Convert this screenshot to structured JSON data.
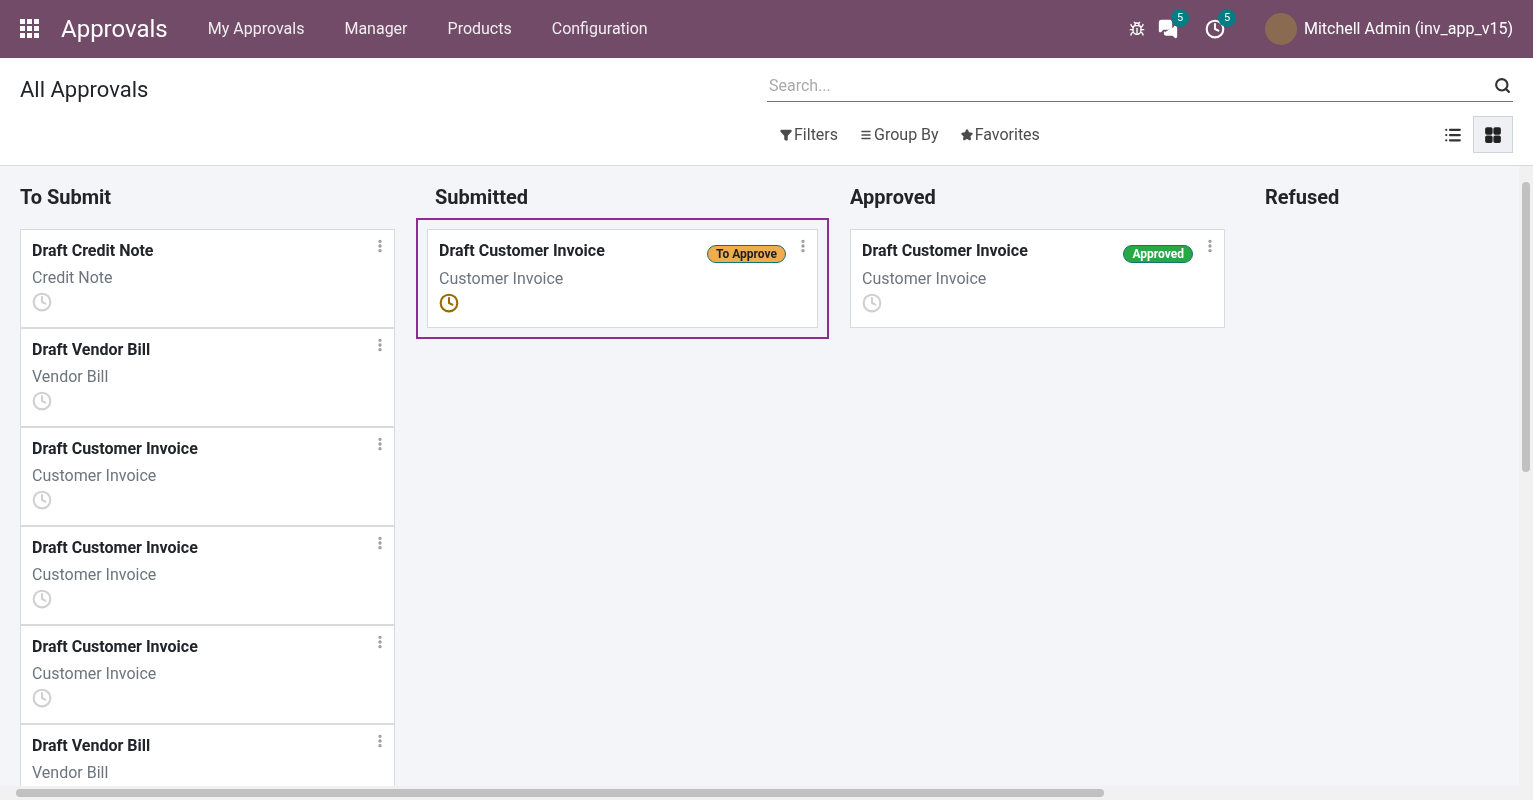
{
  "navbar": {
    "app_title": "Approvals",
    "menu": [
      "My Approvals",
      "Manager",
      "Products",
      "Configuration"
    ],
    "messages_count": "5",
    "activities_count": "5",
    "user": "Mitchell Admin (inv_app_v15)"
  },
  "control_panel": {
    "title": "All Approvals",
    "search": {
      "placeholder": "Search..."
    },
    "filters": [
      "Filters",
      "Group By",
      "Favorites"
    ],
    "views": [
      {
        "kind": "list",
        "selected": false
      },
      {
        "kind": "kanban",
        "selected": true
      }
    ]
  },
  "columns": [
    {
      "title": "To Submit",
      "cards": [
        {
          "title": "Draft Credit Note",
          "subtitle": "Credit Note",
          "activity_planned": false,
          "selected": false
        },
        {
          "title": "Draft Vendor Bill",
          "subtitle": "Vendor Bill",
          "activity_planned": false,
          "selected": false
        },
        {
          "title": "Draft Customer Invoice",
          "subtitle": "Customer Invoice",
          "activity_planned": false,
          "selected": false
        },
        {
          "title": "Draft Customer Invoice",
          "subtitle": "Customer Invoice",
          "activity_planned": false,
          "selected": false
        },
        {
          "title": "Draft Customer Invoice",
          "subtitle": "Customer Invoice",
          "activity_planned": false,
          "selected": false
        },
        {
          "title": "Draft Vendor Bill",
          "subtitle": "Vendor Bill",
          "selected": false
        }
      ]
    },
    {
      "title": "Submitted",
      "cards": [
        {
          "title": "Draft Customer Invoice",
          "subtitle": "Customer Invoice",
          "activity_planned": true,
          "selected": true,
          "badge": {
            "label": "To Approve",
            "kind": "warning"
          }
        }
      ]
    },
    {
      "title": "Approved",
      "cards": [
        {
          "title": "Draft Customer Invoice",
          "subtitle": "Customer Invoice",
          "activity_planned": false,
          "selected": false,
          "badge": {
            "label": "Approved",
            "kind": "success"
          }
        }
      ]
    },
    {
      "title": "Refused"
    }
  ]
}
